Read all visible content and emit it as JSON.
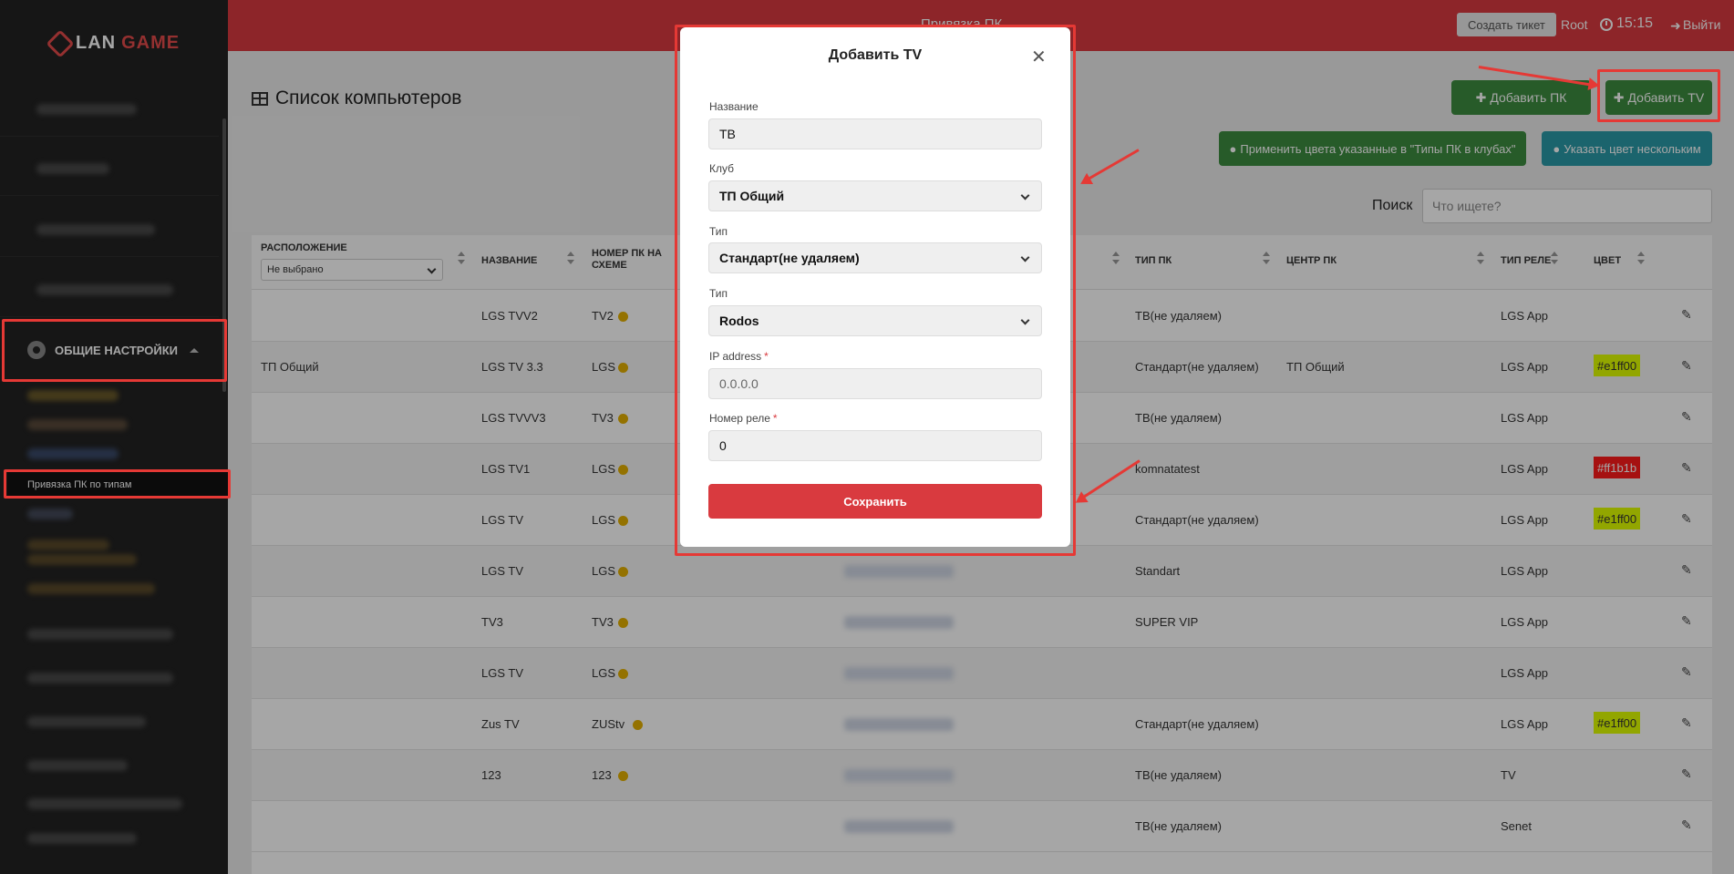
{
  "app": {
    "logo_left": "LAN",
    "logo_right": "GAME"
  },
  "topbar": {
    "title": "Привязка ПК",
    "ticket_button": "Создать тикет",
    "user": "Root",
    "time": "15:15",
    "logout": "Выйти"
  },
  "sidebar": {
    "section_label": "ОБЩИЕ НАСТРОЙКИ",
    "active_item": "Привязка ПК по типам"
  },
  "page": {
    "title": "Список компьютеров",
    "add_pc_button": "Добавить ПК",
    "add_tv_button": "Добавить TV",
    "apply_colors_button": "Применить цвета указанные в \"Типы ПК в клубах\"",
    "set_color_button": "Указать цвет нескольким",
    "search_label": "Поиск",
    "search_placeholder": "Что ищете?"
  },
  "table": {
    "headers": {
      "location": "Расположение",
      "name": "Название",
      "scheme_no": "Номер ПК на схеме",
      "pc_type": "Тип ПК",
      "pc_center": "Центр ПК",
      "relay_type": "Тип реле",
      "color": "Цвет"
    },
    "location_filter": "Не выбрано",
    "rows": [
      {
        "location": "",
        "name": "LGS TVV2",
        "scheme": "TV2",
        "pc_type": "ТВ(не удаляем)",
        "center": "",
        "relay": "LGS App",
        "color": ""
      },
      {
        "location": "ТП Общий",
        "name": "LGS TV 3.3",
        "scheme": "LGS",
        "pc_type": "Стандарт(не удаляем)",
        "center": "ТП Общий",
        "relay": "LGS App",
        "color": "#e1ff00"
      },
      {
        "location": "",
        "name": "LGS TVVV3",
        "scheme": "TV3",
        "pc_type": "ТВ(не удаляем)",
        "center": "",
        "relay": "LGS App",
        "color": ""
      },
      {
        "location": "",
        "name": "LGS TV1",
        "scheme": "LGS",
        "pc_type": "komnatatest",
        "center": "",
        "relay": "LGS App",
        "color": "#ff1b1b"
      },
      {
        "location": "",
        "name": "LGS TV",
        "scheme": "LGS",
        "pc_type": "Стандарт(не удаляем)",
        "center": "",
        "relay": "LGS App",
        "color": "#e1ff00"
      },
      {
        "location": "",
        "name": "LGS TV",
        "scheme": "LGS",
        "pc_type": "Standart",
        "center": "",
        "relay": "LGS App",
        "color": ""
      },
      {
        "location": "",
        "name": "TV3",
        "scheme": "TV3",
        "pc_type": "SUPER VIP",
        "center": "",
        "relay": "LGS App",
        "color": ""
      },
      {
        "location": "",
        "name": "LGS TV",
        "scheme": "LGS",
        "pc_type": "",
        "center": "",
        "relay": "LGS App",
        "color": ""
      },
      {
        "location": "",
        "name": "Zus TV",
        "scheme": "ZUStv",
        "pc_type": "Стандарт(не удаляем)",
        "center": "",
        "relay": "LGS App",
        "color": "#e1ff00"
      },
      {
        "location": "",
        "name": "123",
        "scheme": "123",
        "pc_type": "ТВ(не удаляем)",
        "center": "",
        "relay": "TV",
        "color": ""
      },
      {
        "location": "",
        "name": "",
        "scheme": "",
        "pc_type": "ТВ(не удаляем)",
        "center": "",
        "relay": "Senet",
        "color": ""
      }
    ]
  },
  "modal": {
    "title": "Добавить TV",
    "name_label": "Название",
    "name_value": "ТВ",
    "club_label": "Клуб",
    "club_value": "ТП Общий",
    "type_label": "Тип",
    "type_value": "Стандарт(не удаляем)",
    "type2_label": "Тип",
    "type2_value": "Rodos",
    "ip_label": "IP address",
    "ip_placeholder": "0.0.0.0",
    "relay_label": "Номер реле",
    "relay_value": "0",
    "save_button": "Сохранить"
  },
  "colors": {
    "brand_red": "#d93a3f",
    "green": "#3c8d3f",
    "teal": "#2a9aa8",
    "badge_yellow": "#e1ff00",
    "badge_red": "#ff1b1b",
    "annotation_red": "#e53935"
  }
}
